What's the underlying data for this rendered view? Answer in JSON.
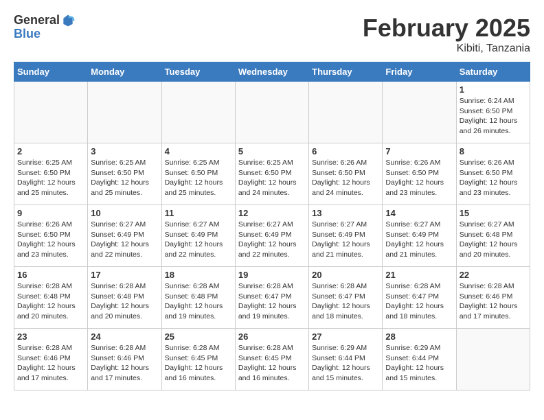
{
  "header": {
    "logo_general": "General",
    "logo_blue": "Blue",
    "month_year": "February 2025",
    "location": "Kibiti, Tanzania"
  },
  "days_of_week": [
    "Sunday",
    "Monday",
    "Tuesday",
    "Wednesday",
    "Thursday",
    "Friday",
    "Saturday"
  ],
  "weeks": [
    [
      {
        "day": "",
        "info": ""
      },
      {
        "day": "",
        "info": ""
      },
      {
        "day": "",
        "info": ""
      },
      {
        "day": "",
        "info": ""
      },
      {
        "day": "",
        "info": ""
      },
      {
        "day": "",
        "info": ""
      },
      {
        "day": "1",
        "info": "Sunrise: 6:24 AM\nSunset: 6:50 PM\nDaylight: 12 hours and 26 minutes."
      }
    ],
    [
      {
        "day": "2",
        "info": "Sunrise: 6:25 AM\nSunset: 6:50 PM\nDaylight: 12 hours and 25 minutes."
      },
      {
        "day": "3",
        "info": "Sunrise: 6:25 AM\nSunset: 6:50 PM\nDaylight: 12 hours and 25 minutes."
      },
      {
        "day": "4",
        "info": "Sunrise: 6:25 AM\nSunset: 6:50 PM\nDaylight: 12 hours and 25 minutes."
      },
      {
        "day": "5",
        "info": "Sunrise: 6:25 AM\nSunset: 6:50 PM\nDaylight: 12 hours and 24 minutes."
      },
      {
        "day": "6",
        "info": "Sunrise: 6:26 AM\nSunset: 6:50 PM\nDaylight: 12 hours and 24 minutes."
      },
      {
        "day": "7",
        "info": "Sunrise: 6:26 AM\nSunset: 6:50 PM\nDaylight: 12 hours and 23 minutes."
      },
      {
        "day": "8",
        "info": "Sunrise: 6:26 AM\nSunset: 6:50 PM\nDaylight: 12 hours and 23 minutes."
      }
    ],
    [
      {
        "day": "9",
        "info": "Sunrise: 6:26 AM\nSunset: 6:50 PM\nDaylight: 12 hours and 23 minutes."
      },
      {
        "day": "10",
        "info": "Sunrise: 6:27 AM\nSunset: 6:49 PM\nDaylight: 12 hours and 22 minutes."
      },
      {
        "day": "11",
        "info": "Sunrise: 6:27 AM\nSunset: 6:49 PM\nDaylight: 12 hours and 22 minutes."
      },
      {
        "day": "12",
        "info": "Sunrise: 6:27 AM\nSunset: 6:49 PM\nDaylight: 12 hours and 22 minutes."
      },
      {
        "day": "13",
        "info": "Sunrise: 6:27 AM\nSunset: 6:49 PM\nDaylight: 12 hours and 21 minutes."
      },
      {
        "day": "14",
        "info": "Sunrise: 6:27 AM\nSunset: 6:49 PM\nDaylight: 12 hours and 21 minutes."
      },
      {
        "day": "15",
        "info": "Sunrise: 6:27 AM\nSunset: 6:48 PM\nDaylight: 12 hours and 20 minutes."
      }
    ],
    [
      {
        "day": "16",
        "info": "Sunrise: 6:28 AM\nSunset: 6:48 PM\nDaylight: 12 hours and 20 minutes."
      },
      {
        "day": "17",
        "info": "Sunrise: 6:28 AM\nSunset: 6:48 PM\nDaylight: 12 hours and 20 minutes."
      },
      {
        "day": "18",
        "info": "Sunrise: 6:28 AM\nSunset: 6:48 PM\nDaylight: 12 hours and 19 minutes."
      },
      {
        "day": "19",
        "info": "Sunrise: 6:28 AM\nSunset: 6:47 PM\nDaylight: 12 hours and 19 minutes."
      },
      {
        "day": "20",
        "info": "Sunrise: 6:28 AM\nSunset: 6:47 PM\nDaylight: 12 hours and 18 minutes."
      },
      {
        "day": "21",
        "info": "Sunrise: 6:28 AM\nSunset: 6:47 PM\nDaylight: 12 hours and 18 minutes."
      },
      {
        "day": "22",
        "info": "Sunrise: 6:28 AM\nSunset: 6:46 PM\nDaylight: 12 hours and 17 minutes."
      }
    ],
    [
      {
        "day": "23",
        "info": "Sunrise: 6:28 AM\nSunset: 6:46 PM\nDaylight: 12 hours and 17 minutes."
      },
      {
        "day": "24",
        "info": "Sunrise: 6:28 AM\nSunset: 6:46 PM\nDaylight: 12 hours and 17 minutes."
      },
      {
        "day": "25",
        "info": "Sunrise: 6:28 AM\nSunset: 6:45 PM\nDaylight: 12 hours and 16 minutes."
      },
      {
        "day": "26",
        "info": "Sunrise: 6:28 AM\nSunset: 6:45 PM\nDaylight: 12 hours and 16 minutes."
      },
      {
        "day": "27",
        "info": "Sunrise: 6:29 AM\nSunset: 6:44 PM\nDaylight: 12 hours and 15 minutes."
      },
      {
        "day": "28",
        "info": "Sunrise: 6:29 AM\nSunset: 6:44 PM\nDaylight: 12 hours and 15 minutes."
      },
      {
        "day": "",
        "info": ""
      }
    ]
  ]
}
